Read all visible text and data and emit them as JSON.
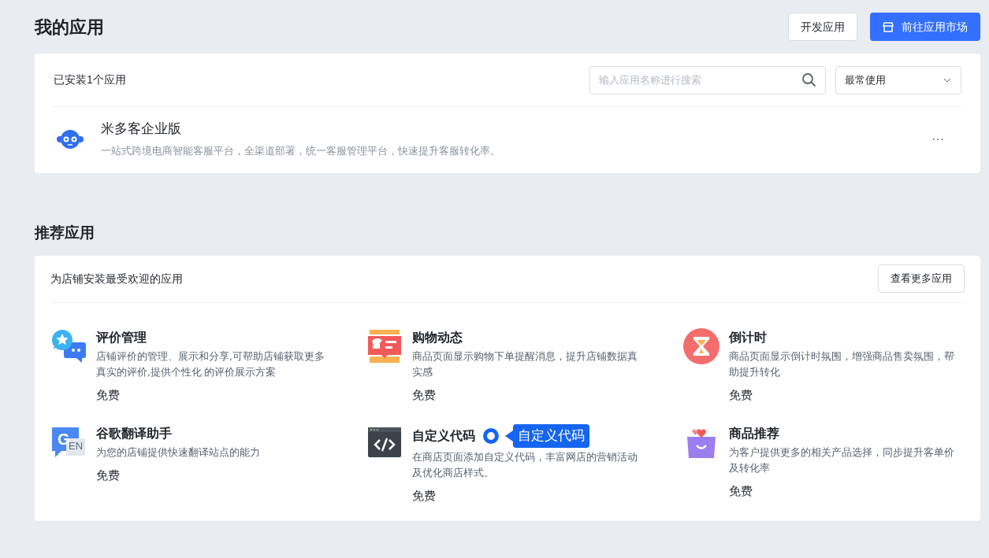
{
  "page_title": "我的应用",
  "header_buttons": [
    {
      "label": "开发应用",
      "kind": "default"
    },
    {
      "label": "前往应用市场",
      "kind": "primary"
    }
  ],
  "installed": {
    "summary": "已安装1个应用",
    "search": {
      "placeholder": "输入应用名称进行搜索"
    },
    "sort": {
      "value": "最常使用"
    },
    "apps": [
      {
        "name": "米多客企业版",
        "description": "一站式跨境电商智能客服平台，全渠道部署，统一客服管理平台，快速提升客服转化率。",
        "menu": "···"
      }
    ]
  },
  "recommended": {
    "title": "推荐应用",
    "subtitle": "为店铺安装最受欢迎的应用",
    "more_button": "查看更多应用",
    "apps": [
      {
        "kind": "review",
        "name": "评价管理",
        "description": "店铺评价的管理、展示和分享,可帮助店铺获取更多真实的评价,提供个性化 的评价展示方案",
        "price": "免费"
      },
      {
        "kind": "shopping",
        "name": "购物动态",
        "description": "商品页面显示购物下单提醒消息，提升店铺数据真实感",
        "price": "免费"
      },
      {
        "kind": "countdown",
        "name": "倒计时",
        "description": "商品页面显示倒计时氛围，增强商品售卖氛围，帮助提升转化",
        "price": "免费"
      },
      {
        "kind": "translate",
        "name": "谷歌翻译助手",
        "description": "为您的店铺提供快速翻译站点的能力",
        "price": "免费",
        "icon_letter": "G",
        "icon_text": "EN"
      },
      {
        "kind": "code",
        "name": "自定义代码",
        "description": "在商店页面添加自定义代码，丰富网店的营销活动及优化商店样式。",
        "price": "免费",
        "annotation": "自定义代码"
      },
      {
        "kind": "recommend",
        "name": "商品推荐",
        "description": "为客户提供更多的相关产品选择，同步提升客单价及转化率",
        "price": "免费"
      }
    ]
  }
}
